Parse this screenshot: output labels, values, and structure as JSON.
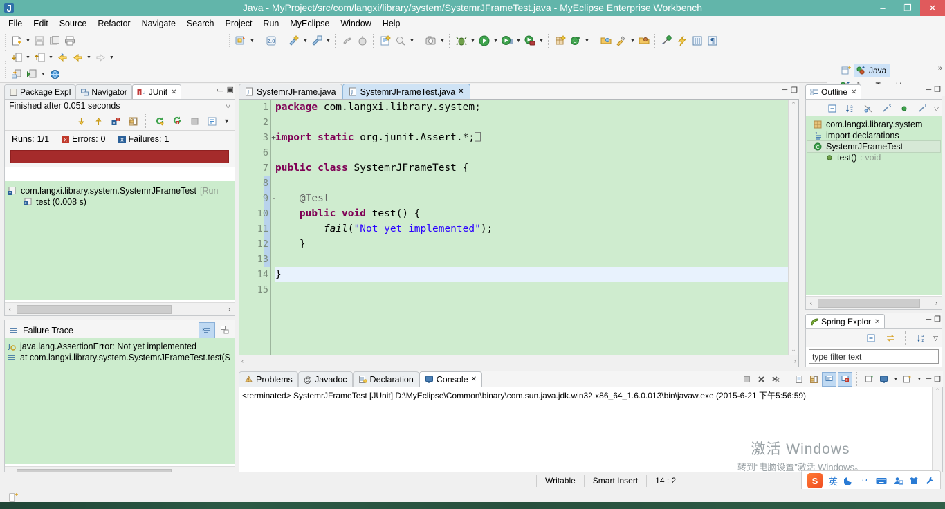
{
  "window": {
    "title": "Java - MyProject/src/com/langxi/library/system/SystemrJFrameTest.java - MyEclipse Enterprise Workbench",
    "minimize_label": "–",
    "maximize_label": "❐",
    "close_label": "✕",
    "titlebar_color": "#62b5aa",
    "close_color": "#e05a5c"
  },
  "menubar": {
    "items": [
      {
        "label": "File"
      },
      {
        "label": "Edit"
      },
      {
        "label": "Source"
      },
      {
        "label": "Refactor"
      },
      {
        "label": "Navigate"
      },
      {
        "label": "Search"
      },
      {
        "label": "Project"
      },
      {
        "label": "Run"
      },
      {
        "label": "MyEclipse"
      },
      {
        "label": "Window"
      },
      {
        "label": "Help"
      }
    ]
  },
  "perspective": {
    "open_label": "open-perspective-icon",
    "active": "Java",
    "secondary": "Java Type H...",
    "overflow": "»"
  },
  "junit": {
    "tabs": [
      {
        "label": "Package Expl",
        "icon": "package-explorer-icon",
        "active": false,
        "closable": false
      },
      {
        "label": "Navigator",
        "icon": "navigator-icon",
        "active": false,
        "closable": false
      },
      {
        "label": "JUnit",
        "icon": "junit-icon",
        "active": true,
        "closable": true
      }
    ],
    "status": "Finished after 0.051 seconds",
    "runs_label": "Runs:",
    "runs_value": "1/1",
    "errors_label": "Errors:",
    "errors_value": "0",
    "failures_label": "Failures:",
    "failures_value": "1",
    "bar_color": "#a52b2b",
    "tree": [
      {
        "label": "com.langxi.library.system.SystemrJFrameTest",
        "suffix": "[Run",
        "indent": 0,
        "icon": "test-class-failed-icon"
      },
      {
        "label": "test (0.008 s)",
        "suffix": "",
        "indent": 1,
        "icon": "test-method-failed-icon"
      }
    ],
    "toolbar": [
      {
        "name": "next-failure-icon"
      },
      {
        "name": "previous-failure-icon"
      },
      {
        "name": "show-failures-only-icon"
      },
      {
        "name": "lock-scroll-icon"
      },
      {
        "name": "rerun-test-icon"
      },
      {
        "name": "rerun-failed-tests-icon"
      },
      {
        "name": "stop-icon"
      },
      {
        "name": "test-run-history-icon"
      },
      {
        "name": "view-menu-icon"
      }
    ]
  },
  "failure_trace": {
    "title": "Failure Trace",
    "toolbar": [
      {
        "name": "filter-stack-trace-icon"
      },
      {
        "name": "compare-result-icon"
      }
    ],
    "rows": [
      {
        "label": "java.lang.AssertionError: Not yet implemented",
        "icon": "exception-icon",
        "indent": 0
      },
      {
        "label": "at com.langxi.library.system.SystemrJFrameTest.test(S",
        "icon": "stack-frame-icon",
        "indent": 0
      }
    ]
  },
  "editor": {
    "tabs": [
      {
        "label": "SystemrJFrame.java",
        "active": false,
        "closable": false
      },
      {
        "label": "SystemrJFrameTest.java",
        "active": true,
        "closable": true
      }
    ],
    "controls": {
      "minimize": "─",
      "maximize": "❐"
    },
    "background_color": "#cfeccf",
    "current_line_color": "#e8f2fd",
    "lines": [
      {
        "num": "1",
        "fold": "",
        "current": false,
        "tokens": [
          {
            "t": "package ",
            "c": "kw"
          },
          {
            "t": "com.langxi.library.system;",
            "c": ""
          }
        ]
      },
      {
        "num": "2",
        "fold": "",
        "current": false,
        "tokens": []
      },
      {
        "num": "3",
        "fold": "+",
        "current": false,
        "tokens": [
          {
            "t": "import static ",
            "c": "kw"
          },
          {
            "t": "org.junit.Assert.*;",
            "c": ""
          },
          {
            "t": "⎕",
            "c": "ann"
          }
        ]
      },
      {
        "num": "6",
        "fold": "",
        "current": false,
        "tokens": []
      },
      {
        "num": "7",
        "fold": "",
        "current": false,
        "tokens": [
          {
            "t": "public class ",
            "c": "kw"
          },
          {
            "t": "SystemrJFrameTest {",
            "c": ""
          }
        ]
      },
      {
        "num": "8",
        "fold": "",
        "current": false,
        "tokens": []
      },
      {
        "num": "9",
        "fold": "-",
        "current": false,
        "tokens": [
          {
            "t": "    @Test",
            "c": "ann"
          }
        ]
      },
      {
        "num": "10",
        "fold": "",
        "current": false,
        "tokens": [
          {
            "t": "    ",
            "c": ""
          },
          {
            "t": "public void ",
            "c": "kw"
          },
          {
            "t": "test() {",
            "c": ""
          }
        ]
      },
      {
        "num": "11",
        "fold": "",
        "current": false,
        "tokens": [
          {
            "t": "        ",
            "c": ""
          },
          {
            "t": "fail",
            "c": "itl"
          },
          {
            "t": "(",
            "c": ""
          },
          {
            "t": "\"Not yet implemented\"",
            "c": "str"
          },
          {
            "t": ");",
            "c": ""
          }
        ]
      },
      {
        "num": "12",
        "fold": "",
        "current": false,
        "tokens": [
          {
            "t": "    }",
            "c": ""
          }
        ]
      },
      {
        "num": "13",
        "fold": "",
        "current": false,
        "tokens": []
      },
      {
        "num": "14",
        "fold": "",
        "current": true,
        "tokens": [
          {
            "t": "}",
            "c": ""
          }
        ]
      },
      {
        "num": "15",
        "fold": "",
        "current": false,
        "tokens": []
      }
    ]
  },
  "console": {
    "tabs": [
      {
        "label": "Problems",
        "icon": "problems-icon",
        "active": false,
        "closable": false
      },
      {
        "label": "Javadoc",
        "icon": "javadoc-icon",
        "active": false,
        "closable": false
      },
      {
        "label": "Declaration",
        "icon": "declaration-icon",
        "active": false,
        "closable": false
      },
      {
        "label": "Console",
        "icon": "console-icon",
        "active": true,
        "closable": true
      }
    ],
    "output": "<terminated> SystemrJFrameTest [JUnit] D:\\MyEclipse\\Common\\binary\\com.sun.java.jdk.win32.x86_64_1.6.0.013\\bin\\javaw.exe (2015-6-21 下午5:56:59)",
    "toolbar": [
      {
        "name": "terminate-icon",
        "active": false
      },
      {
        "name": "remove-launch-icon",
        "active": false
      },
      {
        "name": "remove-all-terminated-icon",
        "active": false
      },
      {
        "name": "clear-console-icon",
        "active": false
      },
      {
        "name": "scroll-lock-icon",
        "active": false
      },
      {
        "name": "show-console-on-output-icon",
        "active": true
      },
      {
        "name": "show-console-on-error-icon",
        "active": true
      },
      {
        "name": "pin-console-icon",
        "active": false
      },
      {
        "name": "display-selected-console-icon",
        "active": false
      },
      {
        "name": "open-console-icon",
        "active": false
      }
    ],
    "controls": {
      "minimize": "─",
      "maximize": "❐"
    }
  },
  "outline": {
    "tab": {
      "label": "Outline",
      "icon": "outline-icon",
      "closable": true
    },
    "controls": {
      "minimize": "─",
      "maximize": "❐"
    },
    "toolbar": [
      {
        "name": "collapse-all-icon"
      },
      {
        "name": "sort-alphabetically-icon"
      },
      {
        "name": "hide-fields-icon"
      },
      {
        "name": "hide-static-members-icon"
      },
      {
        "name": "hide-non-public-members-icon"
      },
      {
        "name": "hide-local-types-icon"
      },
      {
        "name": "view-menu-icon"
      }
    ],
    "rows": [
      {
        "label": "com.langxi.library.system",
        "icon": "package-icon",
        "indent": 1,
        "selected": false,
        "suffix": ""
      },
      {
        "label": "import declarations",
        "icon": "imports-icon",
        "indent": 1,
        "selected": false,
        "suffix": ""
      },
      {
        "label": "SystemrJFrameTest",
        "icon": "class-icon",
        "indent": 1,
        "selected": true,
        "suffix": ""
      },
      {
        "label": "test()",
        "icon": "method-icon",
        "indent": 2,
        "selected": false,
        "suffix": " : void"
      }
    ],
    "hscroll": {
      "left": "‹",
      "right": "›"
    }
  },
  "spring_explorer": {
    "tab": {
      "label": "Spring Explor",
      "icon": "spring-leaf-icon",
      "closable": true
    },
    "controls": {
      "minimize": "─",
      "maximize": "❐"
    },
    "toolbar": [
      {
        "name": "collapse-all-icon"
      },
      {
        "name": "link-with-editor-icon"
      },
      {
        "name": "sort-alphabetically-icon"
      },
      {
        "name": "view-menu-icon"
      }
    ],
    "filter_placeholder": "type filter text"
  },
  "statusbar": {
    "writable": "Writable",
    "insert_mode": "Smart Insert",
    "position": "14 : 2"
  },
  "watermark": {
    "line1": "激活 Windows",
    "line2": "转到“电脑设置”激活 Windows。"
  },
  "ime": {
    "brand": "S",
    "mode": "英",
    "items": [
      {
        "name": "sogou-logo-icon"
      },
      {
        "name": "english-mode-icon"
      },
      {
        "name": "moon-icon"
      },
      {
        "name": "punctuation-icon"
      },
      {
        "name": "soft-keyboard-icon"
      },
      {
        "name": "user-icon"
      },
      {
        "name": "skin-icon"
      },
      {
        "name": "toolbox-icon"
      }
    ]
  },
  "toolbar": {
    "row1": [
      {
        "name": "new-icon",
        "dropdown": true
      },
      {
        "name": "save-icon",
        "dropdown": false
      },
      {
        "name": "save-all-icon",
        "dropdown": false
      },
      {
        "name": "print-icon",
        "dropdown": false
      }
    ],
    "row2": [
      {
        "name": "import-icon",
        "dropdown": true
      },
      {
        "name": "export-icon",
        "dropdown": true
      },
      {
        "name": "back-annotated-icon",
        "dropdown": false
      },
      {
        "name": "back-icon",
        "dropdown": true
      },
      {
        "name": "forward-icon",
        "dropdown": true
      }
    ],
    "row3": [
      {
        "name": "deploy-icon",
        "dropdown": false
      },
      {
        "name": "run-server-icon",
        "dropdown": true
      },
      {
        "name": "open-browser-icon",
        "dropdown": false
      }
    ],
    "main": [
      {
        "name": "myeclipse-deploy-icon",
        "dropdown": true
      },
      {
        "name": "web20-icon",
        "dropdown": false
      },
      {
        "name": "new-wizard-icon",
        "dropdown": true
      },
      {
        "name": "new-resource-icon",
        "dropdown": true
      },
      {
        "name": "build-icon",
        "dropdown": false
      },
      {
        "name": "clean-icon",
        "dropdown": false
      },
      {
        "name": "new-report-icon",
        "dropdown": false
      },
      {
        "name": "search-icon",
        "dropdown": true
      },
      {
        "name": "snapshot-icon",
        "dropdown": true
      },
      {
        "name": "debug-icon",
        "dropdown": true
      },
      {
        "name": "run-icon",
        "dropdown": true
      },
      {
        "name": "run-history-icon",
        "dropdown": true
      },
      {
        "name": "external-tools-icon",
        "dropdown": true
      },
      {
        "name": "new-java-project-icon",
        "dropdown": false
      },
      {
        "name": "new-class-icon",
        "dropdown": true
      },
      {
        "name": "open-type-icon",
        "dropdown": false
      },
      {
        "name": "quick-fix-icon",
        "dropdown": true
      },
      {
        "name": "open-task-icon",
        "dropdown": false
      },
      {
        "name": "tasks-icon",
        "dropdown": false
      },
      {
        "name": "lightning-icon",
        "dropdown": false
      },
      {
        "name": "book-icon",
        "dropdown": false
      },
      {
        "name": "pilcrow-icon",
        "dropdown": false
      }
    ]
  }
}
